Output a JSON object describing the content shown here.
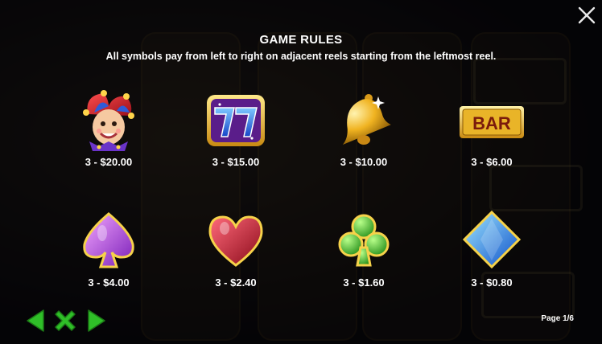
{
  "header": {
    "title": "GAME RULES",
    "subtitle": "All symbols pay from left to right on adjacent reels starting from the leftmost reel."
  },
  "symbols": [
    {
      "name": "joker",
      "payout": "3 - $20.00"
    },
    {
      "name": "seven",
      "payout": "3 - $15.00"
    },
    {
      "name": "bell",
      "payout": "3 - $10.00"
    },
    {
      "name": "bar",
      "payout": "3 - $6.00",
      "label": "BAR"
    },
    {
      "name": "spade",
      "payout": "3 - $4.00"
    },
    {
      "name": "heart",
      "payout": "3 - $2.40"
    },
    {
      "name": "club",
      "payout": "3 - $1.60"
    },
    {
      "name": "diamond",
      "payout": "3 - $0.80"
    }
  ],
  "footer": {
    "page_indicator": "Page 1/6"
  },
  "icons": {
    "close": "close-icon",
    "prev": "prev-arrow-icon",
    "exit": "exit-x-icon",
    "next": "next-arrow-icon"
  },
  "colors": {
    "nav_green": "#2fbf28",
    "text": "#ffffff"
  }
}
